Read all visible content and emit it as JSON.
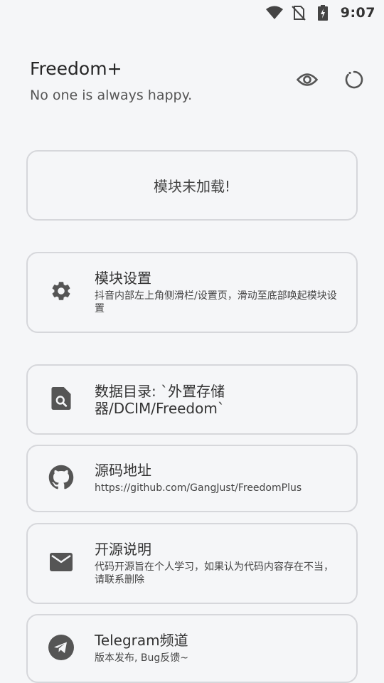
{
  "status_bar": {
    "time": "9:07",
    "icons": [
      "wifi-icon",
      "no-sim-icon",
      "battery-charging-icon"
    ]
  },
  "header": {
    "title": "Freedom+",
    "subtitle": "No one is always happy.",
    "actions": [
      "eye-icon",
      "refresh-icon"
    ]
  },
  "status_card": {
    "text": "模块未加载!"
  },
  "cards": [
    {
      "icon": "gear-icon",
      "title": "模块设置",
      "desc": "抖音内部左上角侧滑栏/设置页，滑动至底部唤起模块设置"
    },
    {
      "icon": "file-search-icon",
      "title": "数据目录: `外置存储器/DCIM/Freedom`",
      "desc": ""
    },
    {
      "icon": "github-icon",
      "title": "源码地址",
      "desc": "https://github.com/GangJust/FreedomPlus"
    },
    {
      "icon": "mail-icon",
      "title": "开源说明",
      "desc": "代码开源旨在个人学习，如果认为代码内容存在不当，请联系删除"
    },
    {
      "icon": "telegram-icon",
      "title": "Telegram频道",
      "desc": "版本发布, Bug反馈~"
    }
  ],
  "colors": {
    "background": "#f5f6f8",
    "card_border": "#d6d7db",
    "icon": "#555555"
  }
}
